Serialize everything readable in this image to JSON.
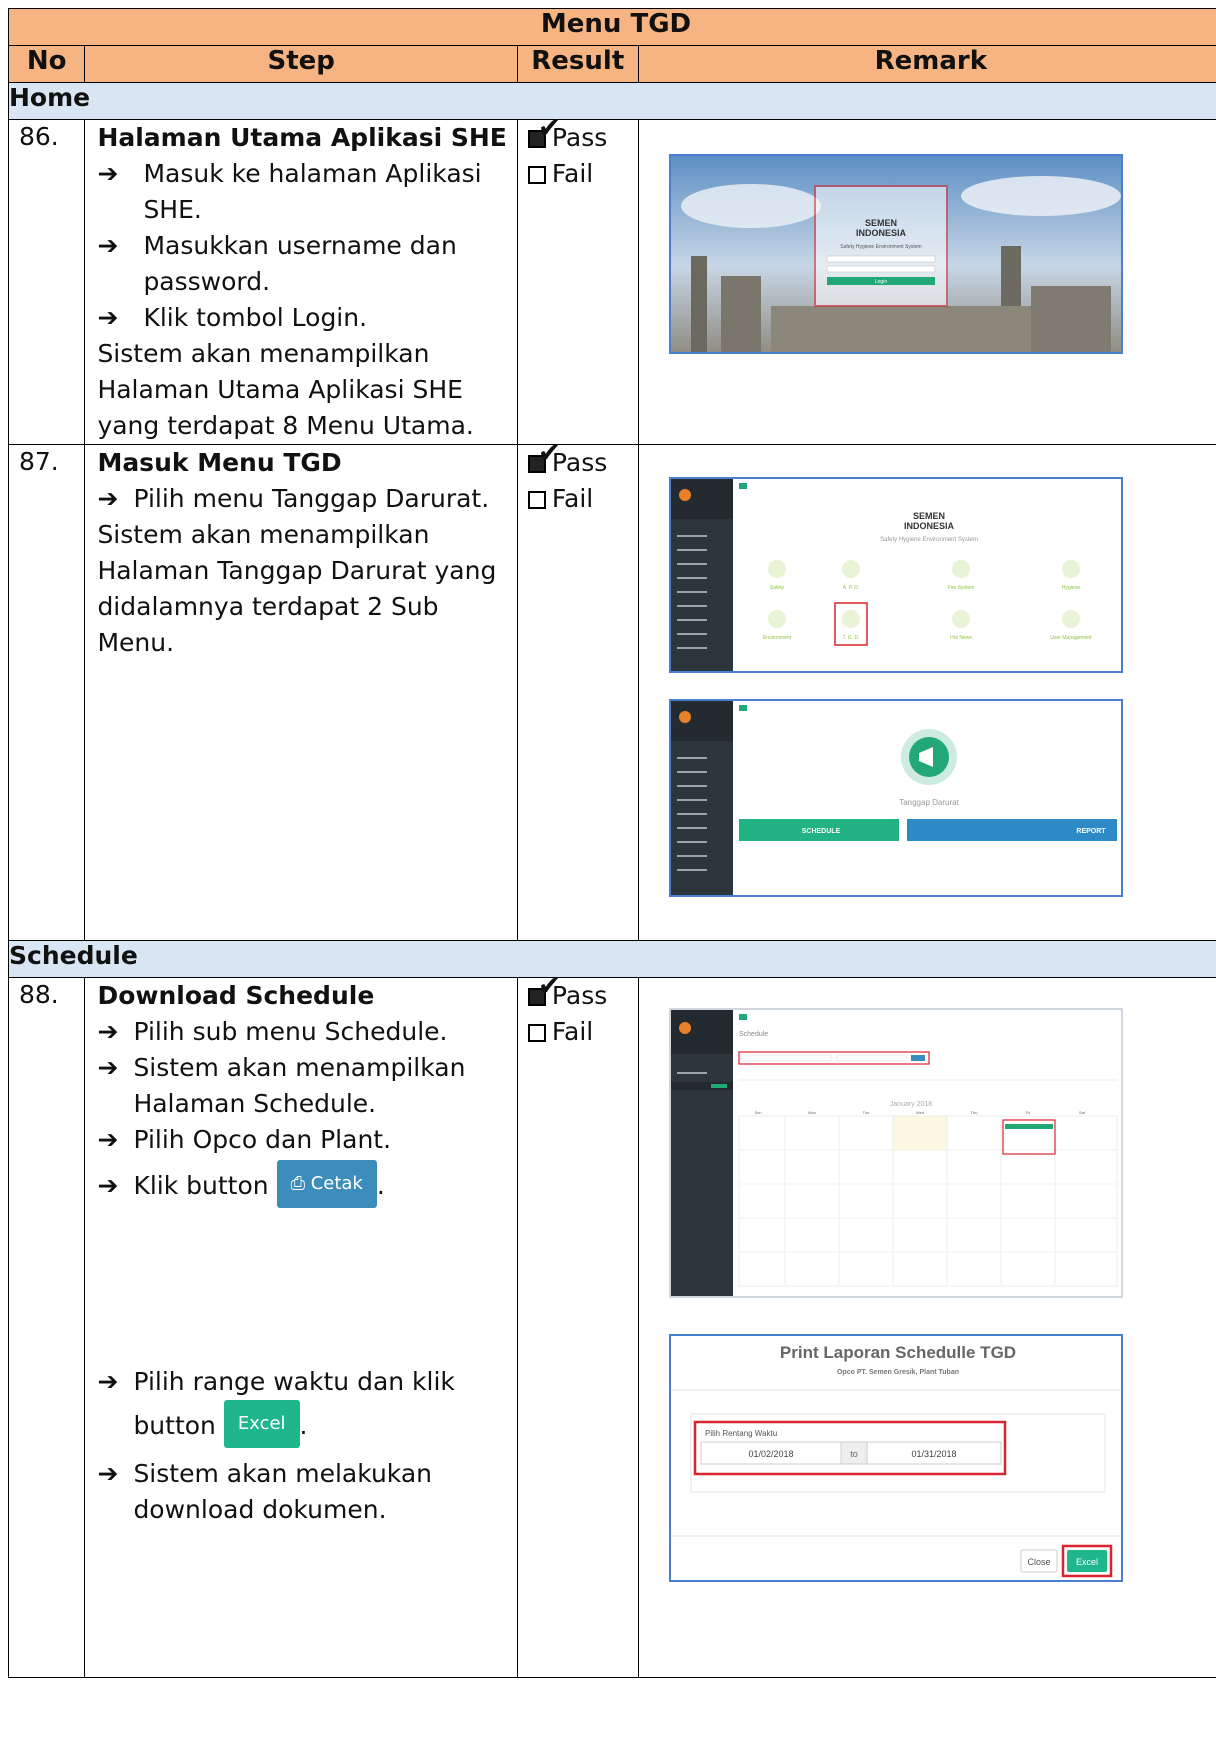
{
  "title": "Menu TGD",
  "headers": {
    "no": "No",
    "step": "Step",
    "result": "Result",
    "remark": "Remark"
  },
  "sections": {
    "home": "Home",
    "schedule": "Schedule"
  },
  "result_pass": "Pass",
  "result_fail": "Fail",
  "row86": {
    "no": "86.",
    "title": "Halaman Utama Aplikasi SHE",
    "steps": [
      "Masuk ke halaman Aplikasi SHE.",
      "Masukkan username dan password.",
      "Klik tombol Login."
    ],
    "desc": "Sistem akan menampilkan Halaman Utama Aplikasi SHE yang terdapat 8 Menu Utama.",
    "shot": {
      "logo_top": "SEMEN",
      "logo_bottom": "INDONESIA",
      "subtitle": "Safety Hygiene Environment System",
      "login": "Login"
    }
  },
  "row87": {
    "no": "87.",
    "title": "Masuk Menu TGD",
    "steps": [
      "Pilih menu Tanggap Darurat."
    ],
    "desc": "Sistem akan menampilkan Halaman Tanggap Darurat yang didalamnya terdapat 2 Sub Menu.",
    "shot1": {
      "logo_top": "SEMEN",
      "logo_bottom": "INDONESIA",
      "subtitle": "Safety Hygiene Environment System",
      "menus": [
        "Safety",
        "A. P. D.",
        "Fire System",
        "Hygiene",
        "Environment",
        "T. G. D.",
        "Hot News",
        "User Management"
      ]
    },
    "shot2": {
      "label": "Tanggap Darurat",
      "schedule": "SCHEDULE",
      "report": "REPORT"
    }
  },
  "row88": {
    "no": "88.",
    "title": "Download Schedule",
    "steps": [
      "Pilih sub menu Schedule.",
      "Sistem akan menampilkan Halaman Schedule.",
      "Pilih Opco dan Plant."
    ],
    "klik_prefix": "Klik button",
    "cetak": "Cetak",
    "step2": "Pilih range waktu dan klik",
    "button_word": "button",
    "excel": "Excel",
    "step3": "Sistem akan melakukan download dokumen.",
    "shot1": {
      "page_title": "Schedule",
      "month": "January 2018",
      "days": [
        "Sun",
        "Mon",
        "Tue",
        "Wed",
        "Thu",
        "Fri",
        "Sat"
      ]
    },
    "shot2": {
      "title": "Print Laporan Schedulle TGD",
      "subtitle": "Opco PT. Semen Gresik, Plant Tuban",
      "range_label": "Pilih Rentang Waktu",
      "from": "01/02/2018",
      "to_word": "to",
      "to": "01/31/2018",
      "close": "Close",
      "excel": "Excel"
    }
  }
}
